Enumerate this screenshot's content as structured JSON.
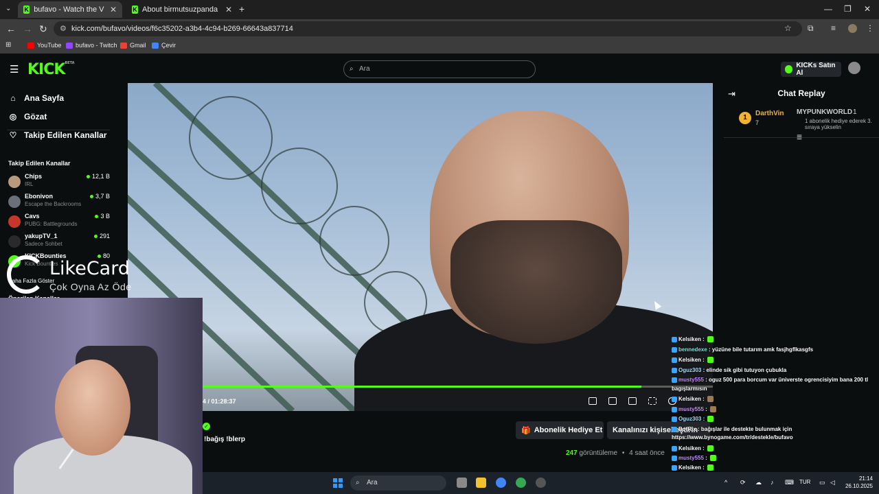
{
  "browser": {
    "tabs": [
      {
        "title": "bufavo - Watch the VOD on",
        "active": true
      },
      {
        "title": "About birmutsuzpanda - Watch",
        "active": false
      }
    ],
    "new_tab": "+",
    "url": "kick.com/bufavo/videos/f6c35202-a3b4-4c94-b269-66643a837714",
    "bookmarks": [
      "YouTube",
      "bufavo - Twitch",
      "Gmail",
      "Çevir"
    ]
  },
  "header": {
    "logo": "KICK",
    "logo_badge": "BETA",
    "search_placeholder": "Ara",
    "kicks_button": "KICKs Satın Al"
  },
  "sidebar": {
    "nav": [
      {
        "label": "Ana Sayfa",
        "icon": "home-icon"
      },
      {
        "label": "Gözat",
        "icon": "compass-icon"
      },
      {
        "label": "Takip Edilen Kanallar",
        "icon": "heart-icon"
      }
    ],
    "followed_title": "Takip Edilen Kanallar",
    "channels": [
      {
        "name": "Chips",
        "category": "IRL",
        "viewers": "12,1 B"
      },
      {
        "name": "Ebonivon",
        "category": "Escape the Backrooms",
        "viewers": "3,7 B"
      },
      {
        "name": "Cavs",
        "category": "PUBG: Battlegrounds",
        "viewers": "3 B"
      },
      {
        "name": "yakupTV_1",
        "category": "Sadece Sohbet",
        "viewers": "291"
      },
      {
        "name": "KICKBounties",
        "category": "Kick Bounties",
        "viewers": "80"
      }
    ],
    "show_more": "Daha Fazla Göster",
    "recommended_title": "Önerilen Kanallar"
  },
  "overlay": {
    "likecard_name": "LikeCard",
    "likecard_tagline": "Çok Oyna  Az Öde"
  },
  "player": {
    "timecode": "4 / 01:28:37",
    "progress": 0.86
  },
  "below_video": {
    "gift_sub_button": "Abonelik Hediye Et",
    "customize_button": "Kanalınızı kişiselleştirin",
    "views": "247",
    "views_label": "görüntüleme",
    "age": "4 saat önce",
    "donate_command": "!bağış !blerp"
  },
  "chat": {
    "title": "Chat Replay",
    "top_gifter": {
      "rank": "1",
      "name": "DarthVin",
      "count": "7"
    },
    "gift_event": {
      "user": "MYPUNKWORLD",
      "count": "1",
      "message": "1 abonelik hediye ederek 3. sıraya yükselin"
    }
  },
  "overlay_chat": [
    {
      "user": "Kelsiken",
      "text": "",
      "user_color": "#ffffff"
    },
    {
      "user": "bennedexe",
      "text": "yüzüne bile tutarım amk fasjhgflkasgfs",
      "user_color": "#7fe0d8"
    },
    {
      "user": "Kelsiken",
      "text": "",
      "user_color": "#ffffff"
    },
    {
      "user": "Oguz303",
      "text": "elinde sik gibi tutuyon çubukla",
      "user_color": "#9fe0ff"
    },
    {
      "user": "musty555",
      "text": "oguz 500 para borcum var üniverste ogrencisiyim bana 200 tl",
      "user_color": "#c58cff"
    },
    {
      "user": "",
      "text": "bagışlarmısın",
      "user_color": "#ffffff"
    },
    {
      "user": "Kelsiken",
      "text": "",
      "user_color": "#ffffff"
    },
    {
      "user": "musty555",
      "text": "",
      "user_color": "#c58cff"
    },
    {
      "user": "Oguz303",
      "text": "",
      "user_color": "#9fe0ff"
    },
    {
      "user": "BotRix",
      "text": "bağışlar ile destekte bulunmak için",
      "user_color": "#ffffff"
    },
    {
      "user": "",
      "text": "https://www.bynogame.com/tr/destekle/bufavo",
      "user_color": "#ffffff"
    },
    {
      "user": "Kelsiken",
      "text": "",
      "user_color": "#ffffff"
    },
    {
      "user": "musty555",
      "text": "",
      "user_color": "#c58cff"
    },
    {
      "user": "Kelsiken",
      "text": "",
      "user_color": "#ffffff"
    },
    {
      "user": "birmutsuzpanda",
      "text": "",
      "user_color": "#ff6b8a"
    },
    {
      "user": "Kelsiken",
      "text": "",
      "user_color": "#ffffff"
    }
  ],
  "taskbar": {
    "search": "Ara",
    "language": "TUR",
    "time": "21:14",
    "date": "26.10.2025"
  },
  "colors": {
    "kick_green": "#53fc18",
    "background": "#0b0e0f",
    "gold": "#f2b233"
  }
}
